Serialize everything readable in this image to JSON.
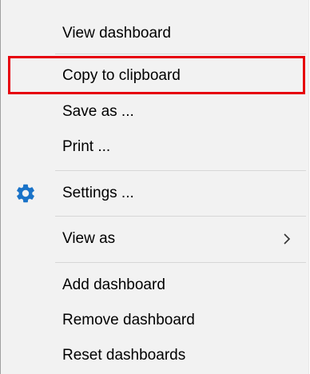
{
  "context_menu": {
    "items": [
      {
        "label": "View dashboard"
      },
      {
        "label": "Copy to clipboard"
      },
      {
        "label": "Save as ..."
      },
      {
        "label": "Print ..."
      },
      {
        "label": "Settings ...",
        "icon": "gear-icon"
      },
      {
        "label": "View as",
        "submenu_icon": "chevron-right-icon"
      },
      {
        "label": "Add dashboard"
      },
      {
        "label": "Remove dashboard"
      },
      {
        "label": "Reset dashboards"
      }
    ],
    "highlighted_item": "Copy to clipboard",
    "highlight_color": "#e6000b",
    "icon_color": "#1a73c8"
  }
}
